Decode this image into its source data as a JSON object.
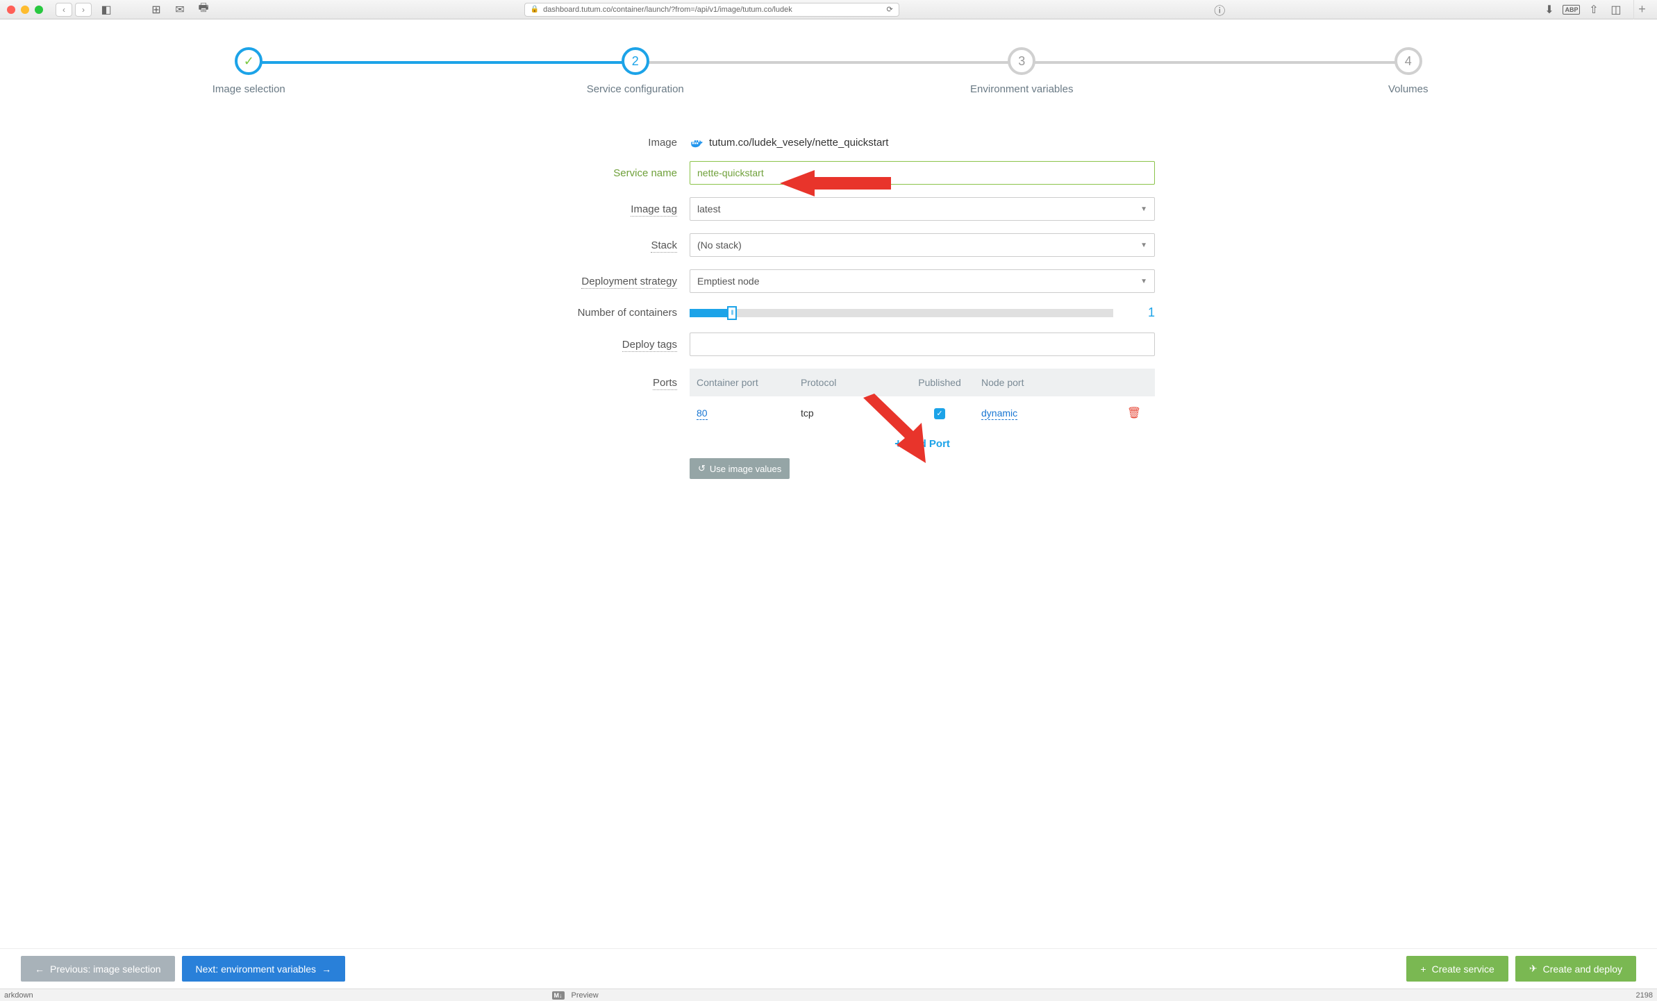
{
  "browser": {
    "url": "dashboard.tutum.co/container/launch/?from=/api/v1/image/tutum.co/ludek",
    "new_tab": "+"
  },
  "wizard": {
    "steps": [
      {
        "label": "Image selection",
        "mark": "✓",
        "state": "completed"
      },
      {
        "label": "Service configuration",
        "mark": "2",
        "state": "active"
      },
      {
        "label": "Environment variables",
        "mark": "3",
        "state": "pending"
      },
      {
        "label": "Volumes",
        "mark": "4",
        "state": "pending"
      }
    ]
  },
  "form": {
    "image_label": "Image",
    "image_value": "tutum.co/ludek_vesely/nette_quickstart",
    "service_name_label": "Service name",
    "service_name_value": "nette-quickstart",
    "image_tag_label": "Image tag",
    "image_tag_value": "latest",
    "stack_label": "Stack",
    "stack_value": "(No stack)",
    "deploy_strategy_label": "Deployment strategy",
    "deploy_strategy_value": "Emptiest node",
    "num_containers_label": "Number of containers",
    "num_containers_value": "1",
    "deploy_tags_label": "Deploy tags",
    "ports_label": "Ports",
    "ports": {
      "headers": {
        "cport": "Container port",
        "proto": "Protocol",
        "pub": "Published",
        "nport": "Node port"
      },
      "rows": [
        {
          "cport": "80",
          "proto": "tcp",
          "published": true,
          "nport": "dynamic"
        }
      ],
      "add_port": "Add Port",
      "use_image_values": "Use image values"
    }
  },
  "footer": {
    "prev": "Previous: image selection",
    "next": "Next: environment variables",
    "create_service": "Create service",
    "create_deploy": "Create and deploy"
  },
  "status": {
    "left": "arkdown",
    "preview": "Preview",
    "right": "2198"
  }
}
